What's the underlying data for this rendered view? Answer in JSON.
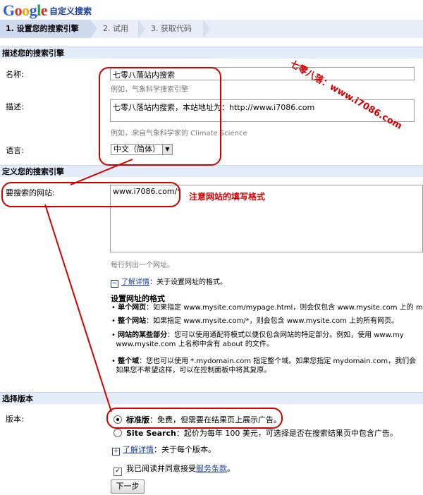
{
  "header": {
    "logo_letters": [
      "G",
      "o",
      "o",
      "g",
      "l",
      "e"
    ],
    "logo_colors": [
      "#2e5fd8",
      "#d62d20",
      "#f0a800",
      "#2e5fd8",
      "#1e9e3c",
      "#d62d20"
    ],
    "product": "自定义搜索"
  },
  "steps": [
    {
      "label": "1. 设置您的搜索引擎"
    },
    {
      "label": "2. 试用"
    },
    {
      "label": "3. 获取代码"
    }
  ],
  "sections": {
    "describe": "描述您的搜索引擎",
    "define": "定义您的搜索引擎",
    "edition": "选择版本"
  },
  "form": {
    "name_label": "名称:",
    "name_value": "七零八落站内搜索",
    "name_hint": "例如，气象科学搜索引擎",
    "desc_label": "描述:",
    "desc_value": "七零八落站内搜索，本站地址为：http://www.i7086.com",
    "desc_hint": "例如，来自气象科学家的 Climate Science",
    "lang_label": "语言:",
    "lang_value": "中文（简体）",
    "sites_label": "要搜索的网站:",
    "sites_value": "www.i7086.com/*",
    "sites_hint": "每行列出一个网址。",
    "learn_more_1_link": "了解详情",
    "learn_more_1_text": "：关于设置网址的格式。",
    "format_title": "设置网址的格式",
    "format_items": [
      {
        "bold": "单个网页",
        "line1": "：如果指定 www.mysite.com/mypage.html，则会仅包含 www.mysite.com 上的 my",
        "line2": ""
      },
      {
        "bold": "整个网站",
        "line1": "：如果指定 www.mysite.com/*，则会包含 www.mysite.com 上的所有网页。",
        "line2": ""
      },
      {
        "bold": "网站的某些部分",
        "line1": "：您可以使用通配符模式以便仅包含网站的特定部分。例如，使用 www.my",
        "line2": "www.mysite.com 上名称中含有 about 的文件。"
      },
      {
        "bold": "整个域",
        "line1": "：您也可以使用 *.mydomain.com 指定整个域。如果您指定 mydomain.com，我们会",
        "line2": "如果您不希望这样，可以在控制面板中将其复原。"
      }
    ],
    "edition_label": "版本:",
    "standard_bold": "标准版",
    "standard_text": "：免费，但需要在结果页上展示广告。",
    "sitesearch_bold": "Site Search",
    "sitesearch_text": "：起价为每年 100 美元，可选择是否在搜索结果页中包含广告。",
    "learn_more_2_link": "了解详情",
    "learn_more_2_text": "：关于每个版本。",
    "agree_text": "我已阅读并同意接受",
    "terms_link": "服务条款",
    "agree_end": "。",
    "next_button": "下一步"
  },
  "annotations": {
    "watermark": "七零八落：www.i7086.com",
    "note": "注意网站的填写格式"
  },
  "colors": {
    "accent_red": "#d40000",
    "link_blue": "#1a3e9a"
  }
}
